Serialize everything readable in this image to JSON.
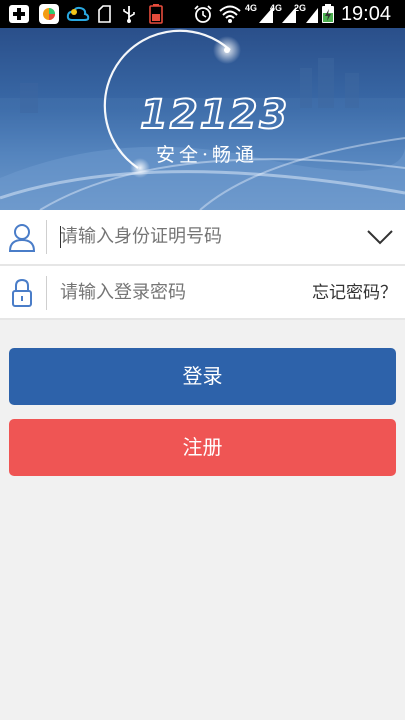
{
  "status_bar": {
    "time": "19:04",
    "network_labels": [
      "4G",
      "4G",
      "2G"
    ],
    "icons": [
      "add-icon",
      "app-icon",
      "cloud-icon",
      "folder-icon",
      "usb-icon",
      "battery-low-icon",
      "alarm-icon",
      "wifi-icon",
      "signal-icon",
      "signal-icon",
      "signal-icon",
      "battery-charging-icon"
    ]
  },
  "hero": {
    "logo_number": "12123",
    "slogan": "安全·畅通"
  },
  "login_form": {
    "id_placeholder": "请输入身份证明号码",
    "password_placeholder": "请输入登录密码",
    "forgot_label": "忘记密码？",
    "icons": {
      "user": "user-icon",
      "lock": "lock-icon",
      "dropdown": "chevron-down-icon"
    }
  },
  "actions": {
    "login_label": "登录",
    "register_label": "注册"
  },
  "colors": {
    "login_button": "#2d62aa",
    "register_button": "#ef5554",
    "accent_icon": "#4a7dc8",
    "background": "#f1f1f1"
  }
}
